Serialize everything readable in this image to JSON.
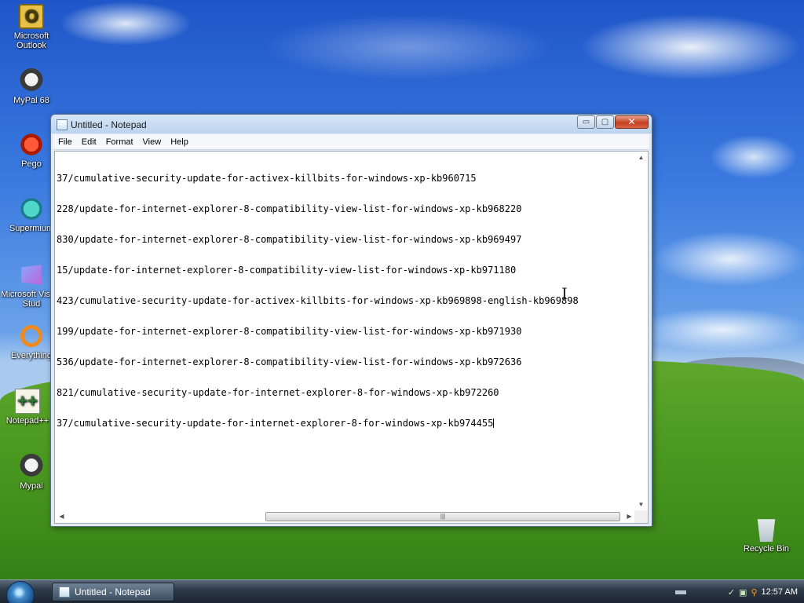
{
  "desktop": {
    "icons": [
      {
        "label": "Microsoft Outlook",
        "icon": "outlook-icon"
      },
      {
        "label": "MyPal 68",
        "icon": "raccoon-icon"
      },
      {
        "label": "Pego",
        "icon": "pego-icon"
      },
      {
        "label": "Supermium",
        "icon": "supermium-icon"
      },
      {
        "label": "Microsoft Visual Stud",
        "icon": "visual-studio-icon"
      },
      {
        "label": "Everything",
        "icon": "everything-icon"
      },
      {
        "label": "Notepad++",
        "icon": "notepadpp-icon"
      },
      {
        "label": "Mypal",
        "icon": "raccoon-icon"
      },
      {
        "label": "Recycle Bin",
        "icon": "recycle-bin-icon"
      }
    ]
  },
  "window": {
    "title": "Untitled - Notepad",
    "caption_buttons": {
      "minimize": "▭",
      "maximize": "▢",
      "close": "✕"
    },
    "menu": [
      "File",
      "Edit",
      "Format",
      "View",
      "Help"
    ],
    "lines": [
      "37/cumulative-security-update-for-activex-killbits-for-windows-xp-kb960715",
      "228/update-for-internet-explorer-8-compatibility-view-list-for-windows-xp-kb968220",
      "830/update-for-internet-explorer-8-compatibility-view-list-for-windows-xp-kb969497",
      "15/update-for-internet-explorer-8-compatibility-view-list-for-windows-xp-kb971180",
      "423/cumulative-security-update-for-activex-killbits-for-windows-xp-kb969898-english-kb969898",
      "199/update-for-internet-explorer-8-compatibility-view-list-for-windows-xp-kb971930",
      "536/update-for-internet-explorer-8-compatibility-view-list-for-windows-xp-kb972636",
      "821/cumulative-security-update-for-internet-explorer-8-for-windows-xp-kb972260",
      "37/cumulative-security-update-for-internet-explorer-8-for-windows-xp-kb974455"
    ]
  },
  "taskbar": {
    "task_label": "Untitled - Notepad",
    "clock": "12:57 AM"
  }
}
